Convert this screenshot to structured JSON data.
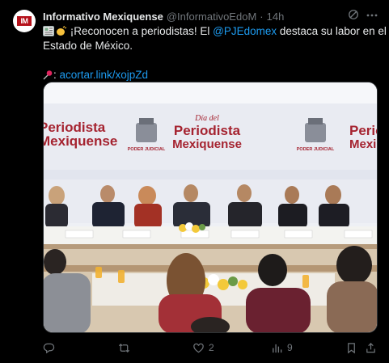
{
  "author": {
    "name": "Informativo Mexiquense",
    "handle": "@InformativoEdoM",
    "separator": "·",
    "time": "14h",
    "avatar_initials": "IM"
  },
  "tweet": {
    "line1_pre": "¡Reconocen a periodistas! El ",
    "mention": "@PJEdomex",
    "line1_post": " destaca su labor en el",
    "line2": "Estado de México.",
    "link_prefix": ": ",
    "link": "acortar.link/xojpZd"
  },
  "media": {
    "banner_title_small": "Día del",
    "banner_title": "Periodista",
    "banner_title2": "Mexiquense",
    "banner_left_title": "Periodista",
    "banner_left_title2": "Mexiquense",
    "logo_label": "PODER JUDICIAL"
  },
  "actions": {
    "replies": "",
    "retweets": "",
    "likes": "2",
    "views": "9"
  },
  "colors": {
    "accent": "#1d9bf0",
    "banner_red": "#a52330",
    "muted": "#71767b"
  }
}
